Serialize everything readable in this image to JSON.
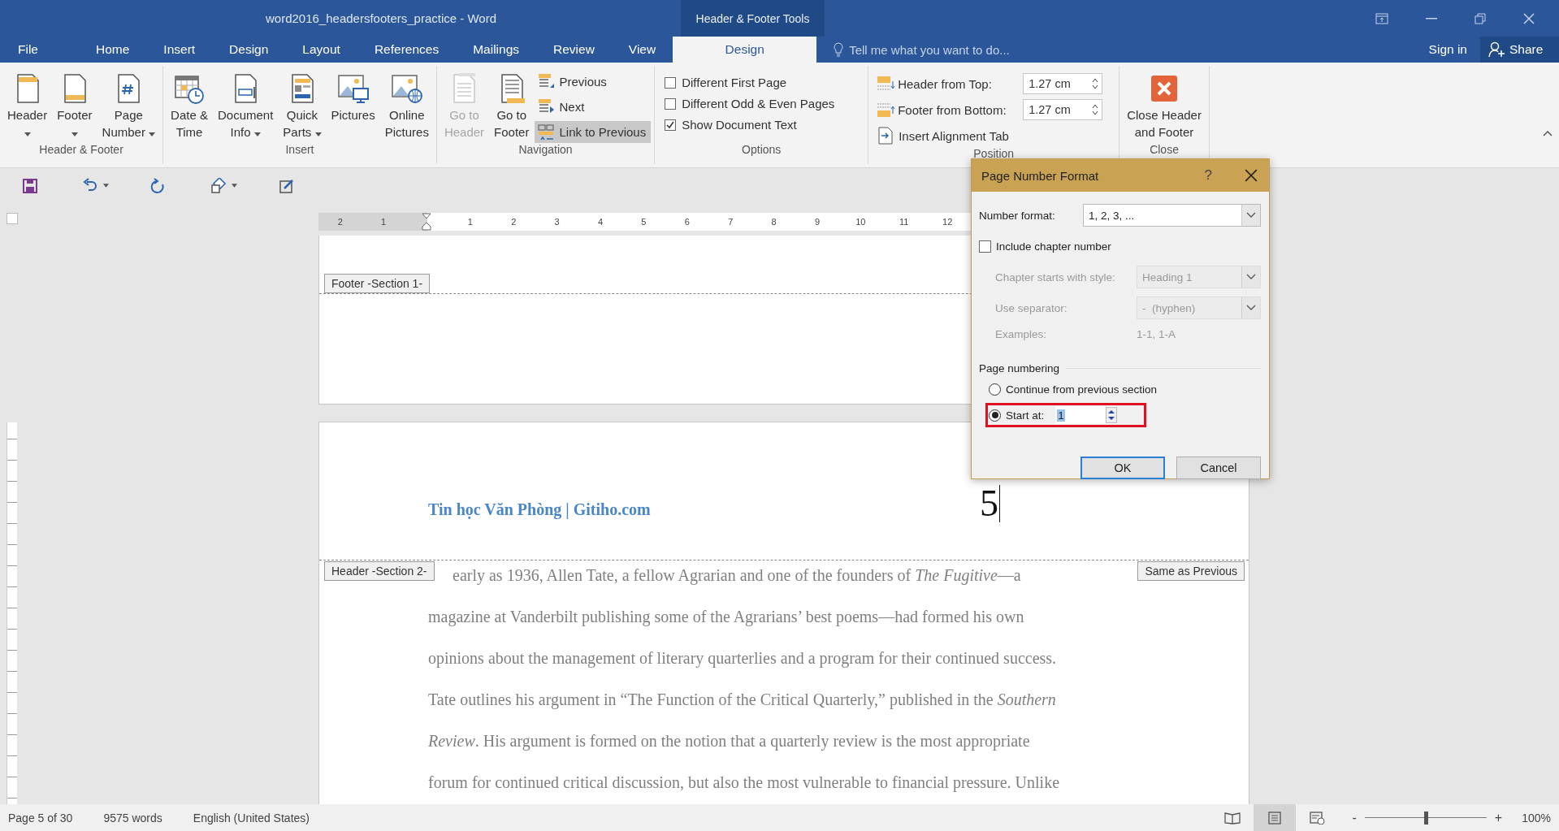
{
  "window": {
    "title": "word2016_headersfooters_practice - Word",
    "context_title": "Header & Footer Tools"
  },
  "tabs": [
    {
      "label": "File",
      "selected": false
    },
    {
      "label": "Home",
      "selected": false
    },
    {
      "label": "Insert",
      "selected": false
    },
    {
      "label": "Design",
      "selected": false
    },
    {
      "label": "Layout",
      "selected": false
    },
    {
      "label": "References",
      "selected": false
    },
    {
      "label": "Mailings",
      "selected": false
    },
    {
      "label": "Review",
      "selected": false
    },
    {
      "label": "View",
      "selected": false
    },
    {
      "label": "Design",
      "selected": true
    }
  ],
  "tell_me": {
    "placeholder": "Tell me what you want to do..."
  },
  "account": {
    "sign_in": "Sign in",
    "share": "Share"
  },
  "ribbon": [
    {
      "label": "Header & Footer",
      "kind": "buttons",
      "items": [
        {
          "kind": "header",
          "label": "Header",
          "dropdown": true,
          "disabled": false
        },
        {
          "kind": "footer",
          "label": "Footer",
          "dropdown": true,
          "disabled": false
        },
        {
          "kind": "page-number",
          "label": "Page\nNumber",
          "dropdown": true,
          "disabled": false
        }
      ]
    },
    {
      "label": "Insert",
      "kind": "buttons",
      "items": [
        {
          "kind": "date-time",
          "label": "Date &\nTime",
          "dropdown": false,
          "disabled": false
        },
        {
          "kind": "document-info",
          "label": "Document\nInfo",
          "dropdown": true,
          "disabled": false
        },
        {
          "kind": "quick-parts",
          "label": "Quick\nParts",
          "dropdown": true,
          "disabled": false
        },
        {
          "kind": "pictures",
          "label": "Pictures",
          "dropdown": false,
          "disabled": false
        },
        {
          "kind": "online-pictures",
          "label": "Online\nPictures",
          "dropdown": false,
          "disabled": false
        }
      ]
    },
    {
      "label": "Navigation",
      "kind": "buttons",
      "items": [
        {
          "kind": "go-to-header",
          "label": "Go to\nHeader",
          "dropdown": false,
          "disabled": true
        },
        {
          "kind": "go-to-footer",
          "label": "Go to\nFooter",
          "dropdown": false,
          "disabled": false
        },
        {
          "kind": "previous",
          "label": "Previous",
          "disabled": false,
          "on": false
        },
        {
          "kind": "next",
          "label": "Next",
          "disabled": false,
          "on": false
        },
        {
          "kind": "link-to-previous",
          "label": "Link to Previous",
          "disabled": false,
          "on": true
        }
      ]
    },
    {
      "label": "Options",
      "kind": "options",
      "items": [
        {
          "label": "Different First Page",
          "checked": false
        },
        {
          "label": "Different Odd & Even Pages",
          "checked": false
        },
        {
          "label": "Show Document Text",
          "checked": true
        }
      ]
    },
    {
      "label": "Position",
      "kind": "position",
      "items": [
        {
          "kind": "spin",
          "label": "Header from Top:",
          "value": "1.27 cm"
        },
        {
          "kind": "spin",
          "label": "Footer from Bottom:",
          "value": "1.27 cm"
        },
        {
          "kind": "button",
          "label": "Insert Alignment Tab"
        }
      ]
    },
    {
      "label": "Close",
      "kind": "buttons",
      "items": [
        {
          "kind": "close",
          "label": "Close Header\nand Footer",
          "dropdown": false,
          "disabled": false
        }
      ]
    }
  ],
  "quick_access": [
    {
      "kind": "save",
      "dropdown": false
    },
    {
      "kind": "undo",
      "dropdown": true
    },
    {
      "kind": "repeat",
      "dropdown": false
    },
    {
      "kind": "shapes",
      "dropdown": true
    },
    {
      "kind": "edit",
      "dropdown": false
    }
  ],
  "ruler": {
    "labels": [
      "2",
      "1",
      "1",
      "2",
      "3",
      "4",
      "5",
      "6",
      "7",
      "8",
      "9",
      "10",
      "11",
      "12"
    ]
  },
  "document": {
    "footer_tag": "Footer -Section 1-",
    "header_text": "Tin học Văn Phòng | Gitiho.com",
    "page_number": "5",
    "header_tag": "Header -Section 2-",
    "same_as_previous": "Same as Previous",
    "body_lines": [
      "early as 1936, Allen Tate, a fellow Agrarian and one of the founders of *The Fugitive*—a",
      "magazine at Vanderbilt publishing some of the Agrarians’ best poems—had formed his own",
      "opinions about the management of literary quarterlies and a program for their continued success.",
      "Tate outlines his argument in “The Function of the Critical Quarterly,” published in the *Southern*",
      "*Review*. His argument is formed on the notion that a quarterly review is the most appropriate",
      "forum for continued critical discussion, but also the most vulnerable to financial pressure. Unlike"
    ]
  },
  "dialog": {
    "title": "Page Number Format",
    "help": "?",
    "number_format": {
      "label": "Number format:",
      "value": "1, 2, 3, ..."
    },
    "include_chapter": {
      "label": "Include chapter number",
      "checked": false
    },
    "chapter_style": {
      "label": "Chapter starts with style:",
      "value": "Heading 1",
      "disabled": true
    },
    "separator": {
      "label": "Use separator:",
      "value": "-  (hyphen)",
      "disabled": true
    },
    "examples": {
      "label": "Examples:",
      "value": "1-1, 1-A",
      "disabled": true
    },
    "page_numbering": {
      "label": "Page numbering",
      "options": [
        {
          "label": "Continue from previous section",
          "selected": false,
          "highlighted": false
        },
        {
          "label": "Start at:",
          "selected": true,
          "highlighted": true,
          "value": "1",
          "value_selected": true
        }
      ]
    },
    "buttons": [
      {
        "label": "OK",
        "default": true
      },
      {
        "label": "Cancel",
        "default": false
      }
    ]
  },
  "status_bar": {
    "page": "Page 5 of 30",
    "words": "9575 words",
    "language": "English (United States)",
    "views": [
      {
        "kind": "read",
        "selected": false
      },
      {
        "kind": "print",
        "selected": true
      },
      {
        "kind": "web",
        "selected": false
      }
    ],
    "zoom": {
      "minus": "-",
      "plus": "+",
      "level": 0.5,
      "value": "100%"
    }
  }
}
